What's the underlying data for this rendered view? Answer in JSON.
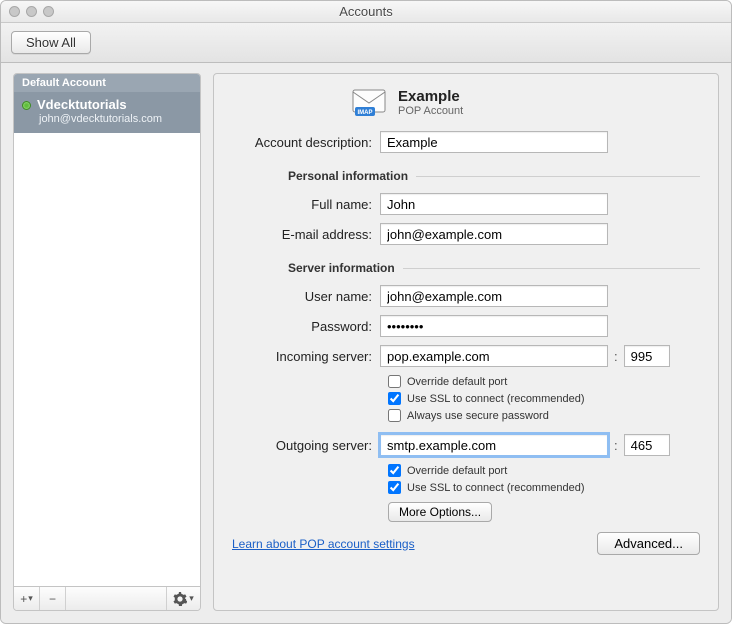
{
  "window": {
    "title": "Accounts",
    "showAllLabel": "Show All"
  },
  "sidebar": {
    "defaultHeader": "Default Account",
    "accountName": "Vdecktutorials",
    "accountEmail": "john@vdecktutorials.com",
    "addLabel": "+",
    "dropLabel": "▾",
    "removeLabel": "−",
    "gearDrop": "▾"
  },
  "header": {
    "title": "Example",
    "subtitle": "POP Account",
    "imapTag": "IMAP"
  },
  "labels": {
    "accountDescription": "Account description:",
    "personalInfo": "Personal information",
    "fullName": "Full name:",
    "email": "E-mail address:",
    "serverInfo": "Server information",
    "userName": "User name:",
    "password": "Password:",
    "incoming": "Incoming server:",
    "outgoing": "Outgoing server:",
    "overridePort": "Override default port",
    "useSSL": "Use SSL to connect (recommended)",
    "securePwd": "Always use secure password",
    "moreOptions": "More Options...",
    "learnLink": "Learn about POP account settings",
    "advanced": "Advanced...",
    "colon": ":"
  },
  "values": {
    "accountDescription": "Example",
    "fullName": "John",
    "email": "john@example.com",
    "userName": "john@example.com",
    "password": "••••••••",
    "incomingServer": "pop.example.com",
    "incomingPort": "995",
    "outgoingServer": "smtp.example.com",
    "outgoingPort": "465"
  },
  "checks": {
    "inOverride": false,
    "inSSL": true,
    "inSecurePwd": false,
    "outOverride": true,
    "outSSL": true
  }
}
